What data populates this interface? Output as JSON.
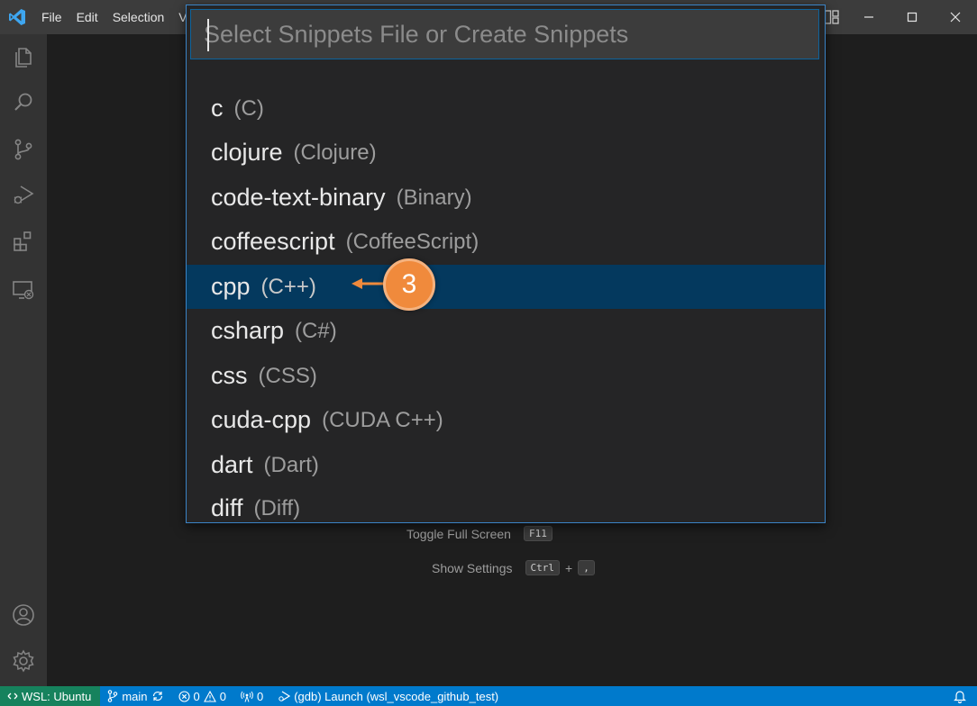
{
  "menu": [
    "File",
    "Edit",
    "Selection",
    "V"
  ],
  "quickpick": {
    "placeholder": "Select Snippets File or Create Snippets",
    "items": [
      {
        "name": "c",
        "desc": "(C)"
      },
      {
        "name": "clojure",
        "desc": "(Clojure)"
      },
      {
        "name": "code-text-binary",
        "desc": "(Binary)"
      },
      {
        "name": "coffeescript",
        "desc": "(CoffeeScript)"
      },
      {
        "name": "cpp",
        "desc": "(C++)"
      },
      {
        "name": "csharp",
        "desc": "(C#)"
      },
      {
        "name": "css",
        "desc": "(CSS)"
      },
      {
        "name": "cuda-cpp",
        "desc": "(CUDA C++)"
      },
      {
        "name": "dart",
        "desc": "(Dart)"
      },
      {
        "name": "diff",
        "desc": "(Diff)"
      }
    ]
  },
  "annotation": {
    "step": "3",
    "color": "#f08a3c"
  },
  "hints": [
    {
      "label": "Toggle Full Screen",
      "keys": [
        "F11"
      ]
    },
    {
      "label": "Show Settings",
      "keys": [
        "Ctrl",
        "+",
        ","
      ]
    }
  ],
  "statusbar": {
    "remote": "WSL: Ubuntu",
    "branch": "main",
    "errors": "0",
    "warnings": "0",
    "ports": "0",
    "launch": "(gdb) Launch (wsl_vscode_github_test)"
  },
  "colors": {
    "accent": "#007acc",
    "selection": "#04395e",
    "remote": "#16825d"
  }
}
